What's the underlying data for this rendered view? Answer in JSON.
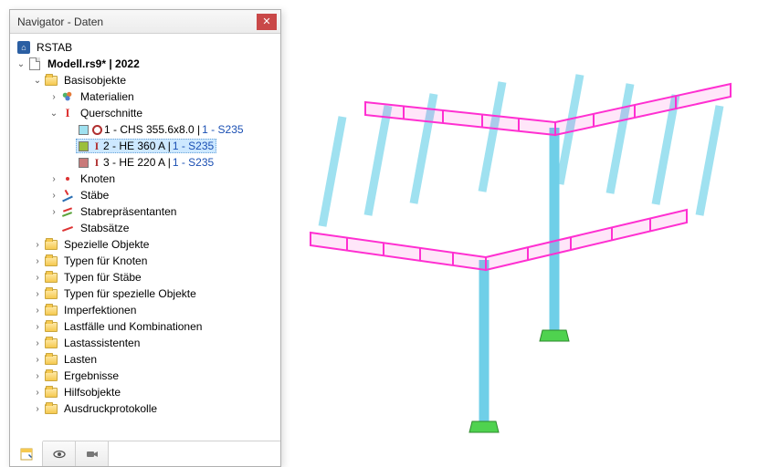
{
  "window": {
    "title": "Navigator - Daten"
  },
  "tree": {
    "root": {
      "label": "RSTAB"
    },
    "model": {
      "label": "Modell.rs9* | 2022"
    },
    "basic": {
      "label": "Basisobjekte"
    },
    "materials": {
      "label": "Materialien"
    },
    "sections": {
      "label": "Querschnitte"
    },
    "section_items": [
      {
        "swatch": "#9fe1f0",
        "shape": "circle",
        "label": "1 - CHS 355.6x8.0",
        "material": "1 - S235"
      },
      {
        "swatch": "#9bbf3a",
        "shape": "i",
        "label": "2 - HE 360 A",
        "material": "1 - S235"
      },
      {
        "swatch": "#c97a7a",
        "shape": "i",
        "label": "3 - HE 220 A",
        "material": "1 - S235"
      }
    ],
    "selected_section": 1,
    "knoten": {
      "label": "Knoten"
    },
    "stabe": {
      "label": "Stäbe"
    },
    "stabrep": {
      "label": "Stabrepräsentanten"
    },
    "stabsatz": {
      "label": "Stabsätze"
    },
    "folders": [
      "Spezielle Objekte",
      "Typen für Knoten",
      "Typen für Stäbe",
      "Typen für spezielle Objekte",
      "Imperfektionen",
      "Lastfälle und Kombinationen",
      "Lastassistenten",
      "Lasten",
      "Ergebnisse",
      "Hilfsobjekte",
      "Ausdruckprotokolle"
    ]
  },
  "tabs": {
    "data": "data-tab",
    "display": "display-tab",
    "views": "views-tab"
  },
  "colors": {
    "purlin": "#9fe1f0",
    "column": "#6fcfe8",
    "beam_highlight": "#ff2fd1",
    "footing": "#4fd24f"
  }
}
